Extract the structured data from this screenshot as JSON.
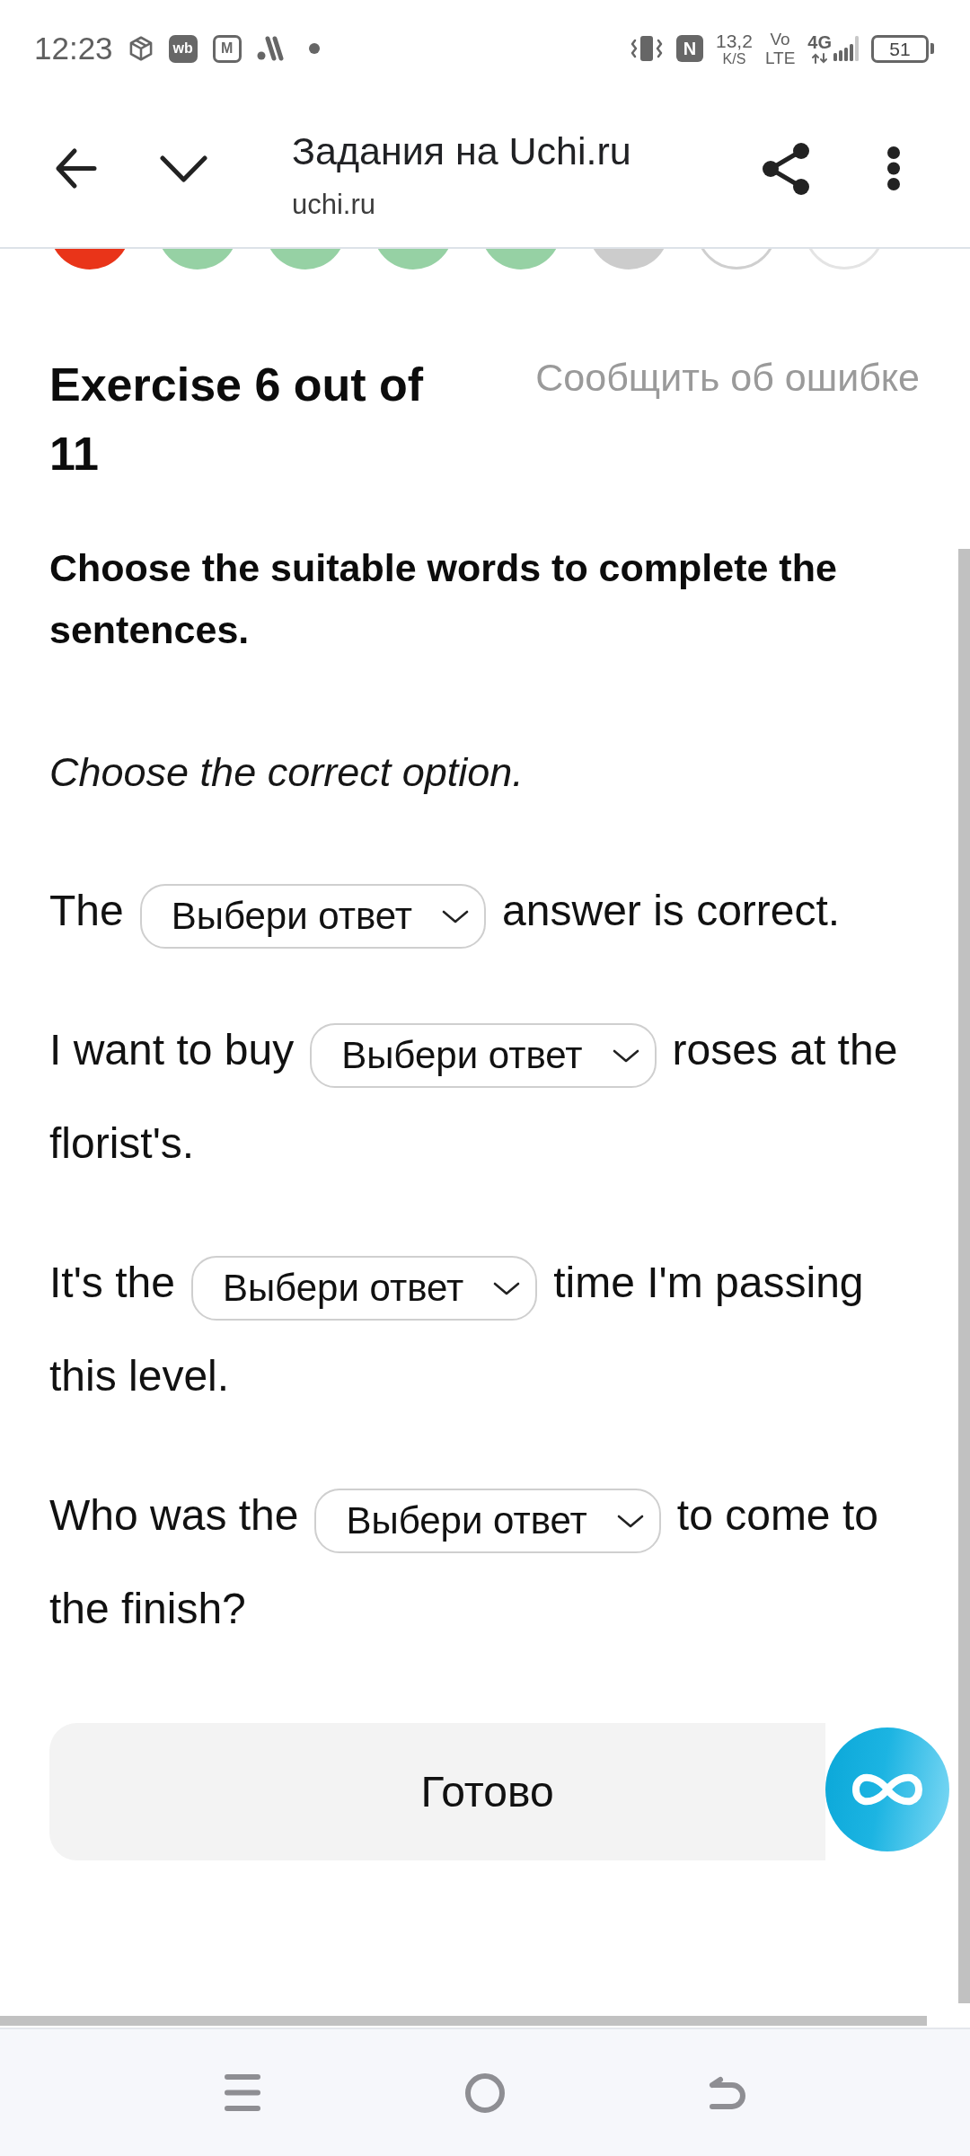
{
  "status_bar": {
    "time": "12:23",
    "app_badges": [
      {
        "kind": "filled",
        "label": "wb"
      },
      {
        "kind": "outlined",
        "label": "M"
      }
    ],
    "nfc": "N",
    "speed": {
      "value": "13,2",
      "unit": "K/S"
    },
    "volte": {
      "top": "Vo",
      "bottom": "LTE"
    },
    "network": "4G",
    "battery": "51"
  },
  "header": {
    "title": "Задания на Uchi.ru",
    "subtitle": "uchi.ru"
  },
  "progress": [
    {
      "kind": "filled",
      "color": "#e93419"
    },
    {
      "kind": "filled",
      "color": "#96d1a4"
    },
    {
      "kind": "filled",
      "color": "#96d1a4"
    },
    {
      "kind": "filled",
      "color": "#96d1a4"
    },
    {
      "kind": "filled",
      "color": "#96d1a4"
    },
    {
      "kind": "filled",
      "color": "#cccccc"
    },
    {
      "kind": "outlined",
      "color": "#cfcfcf"
    },
    {
      "kind": "outlined",
      "color": "#e4e4e4"
    }
  ],
  "exercise": {
    "title": "Exercise 6 out of 11",
    "report_link": "Сообщить об ошибке"
  },
  "instruction": "Choose the suitable words to complete the sentences.",
  "hint": "Choose the correct option.",
  "sentences": [
    {
      "before": "The",
      "placeholder": "Выбери ответ",
      "after": "answer is correct."
    },
    {
      "before": "I want to buy",
      "placeholder": "Выбери ответ",
      "after": "roses at the",
      "continuation": "florist's."
    },
    {
      "before": "It's the",
      "placeholder": "Выбери ответ",
      "after": "time I'm passing",
      "continuation": "this level."
    },
    {
      "before": "Who was the",
      "placeholder": "Выбери ответ",
      "after": "to come to",
      "continuation": "the finish?"
    }
  ],
  "done_button": "Готово"
}
